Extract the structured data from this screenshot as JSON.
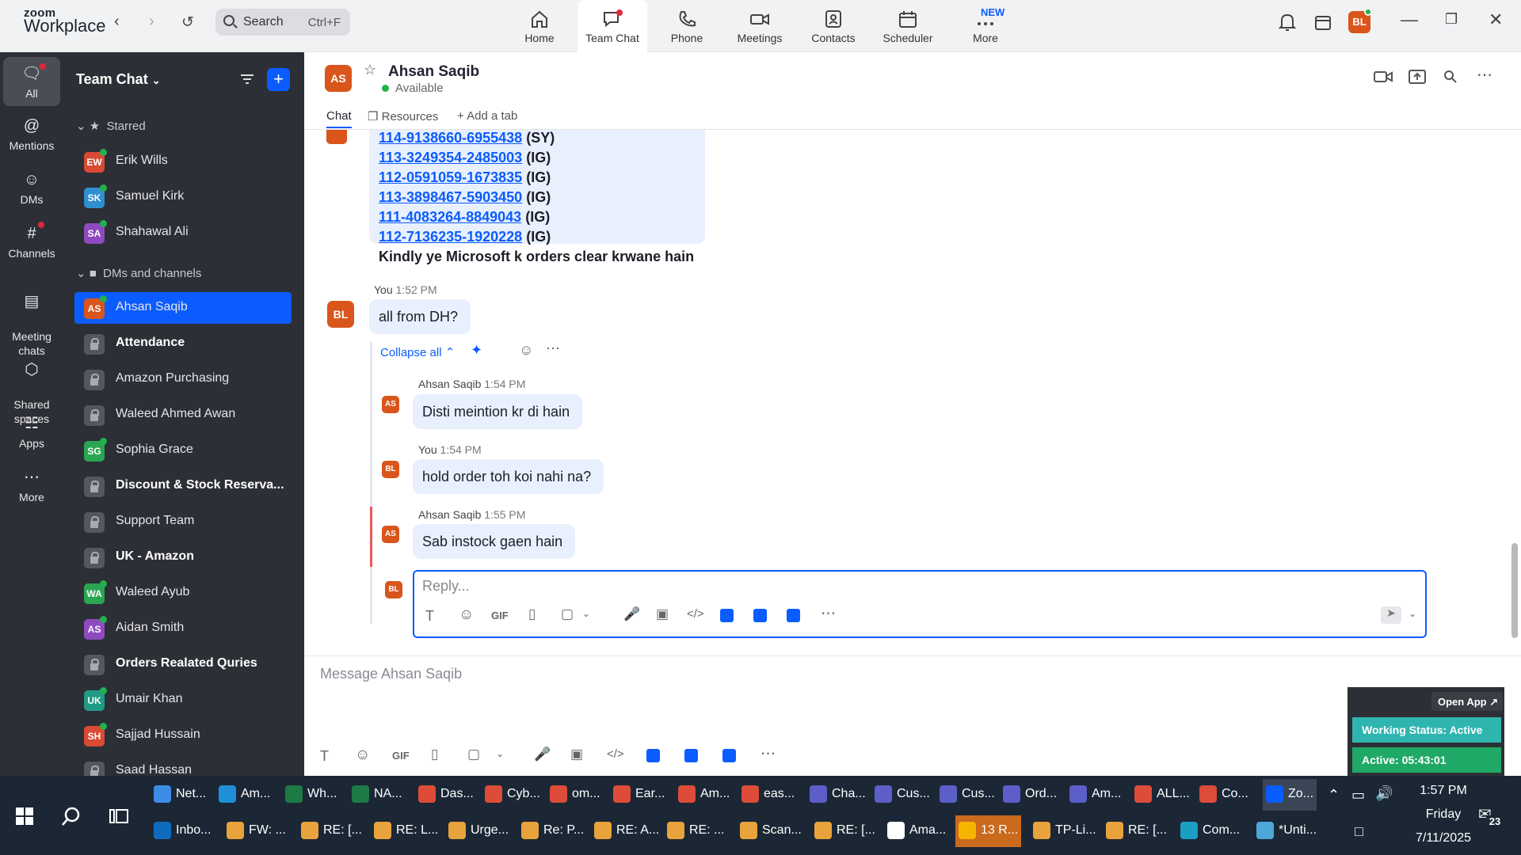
{
  "app": {
    "logo_top": "zoom",
    "logo_bottom": "Workplace"
  },
  "search": {
    "label": "Search",
    "shortcut": "Ctrl+F"
  },
  "nav": [
    {
      "label": "Home",
      "icon": "home-icon"
    },
    {
      "label": "Team Chat",
      "icon": "chat-icon"
    },
    {
      "label": "Phone",
      "icon": "phone-icon"
    },
    {
      "label": "Meetings",
      "icon": "video-icon"
    },
    {
      "label": "Contacts",
      "icon": "contacts-icon"
    },
    {
      "label": "Scheduler",
      "icon": "calendar-icon"
    },
    {
      "label": "More",
      "icon": "more-icon"
    }
  ],
  "new_badge": "NEW",
  "user_initials": "BL",
  "rail": [
    {
      "label": "All"
    },
    {
      "label": "Mentions"
    },
    {
      "label": "DMs"
    },
    {
      "label": "Channels"
    },
    {
      "label": "Meeting\nchats"
    },
    {
      "label": "Shared\nspaces"
    },
    {
      "label": "Apps"
    },
    {
      "label": "More"
    }
  ],
  "sidebar": {
    "title": "Team Chat",
    "starred_label": "Starred",
    "dms_label": "DMs and channels",
    "starred": [
      {
        "initials": "EW",
        "name": "Erik Wills",
        "color": "#d94a33"
      },
      {
        "initials": "SK",
        "name": "Samuel Kirk",
        "color": "#2f8fcf"
      },
      {
        "initials": "SA",
        "name": "Shahawal Ali",
        "color": "#8d4bbf"
      }
    ],
    "items": [
      {
        "initials": "AS",
        "name": "Ahsan Saqib",
        "color": "#d9551c",
        "bold": false
      },
      {
        "initials": "",
        "name": "Attendance",
        "bold": true
      },
      {
        "initials": "",
        "name": "Amazon Purchasing",
        "bold": false
      },
      {
        "initials": "",
        "name": "Waleed Ahmed Awan",
        "bold": false
      },
      {
        "initials": "SG",
        "name": "Sophia Grace",
        "color": "#2aa652",
        "bold": false
      },
      {
        "initials": "",
        "name": "Discount & Stock Reserva...",
        "bold": true
      },
      {
        "initials": "",
        "name": "Support Team",
        "bold": false
      },
      {
        "initials": "",
        "name": "UK - Amazon",
        "bold": true
      },
      {
        "initials": "WA",
        "name": "Waleed Ayub",
        "color": "#2aa652",
        "bold": false
      },
      {
        "initials": "AS",
        "name": "Aidan Smith",
        "color": "#8d4bbf",
        "bold": false
      },
      {
        "initials": "",
        "name": "Orders Realated Quries",
        "bold": true
      },
      {
        "initials": "UK",
        "name": "Umair Khan",
        "color": "#1f9b86",
        "bold": false
      },
      {
        "initials": "SH",
        "name": "Sajjad Hussain",
        "color": "#d94a33",
        "bold": false
      },
      {
        "initials": "",
        "name": "Saad Hassan",
        "bold": false
      }
    ]
  },
  "chat": {
    "contact_initials": "AS",
    "contact_name": "Ahsan Saqib",
    "status": "Available",
    "tabs": {
      "chat": "Chat",
      "resources": "Resources",
      "add": "Add a tab"
    }
  },
  "messages": {
    "order_lines": [
      {
        "id": "114-9138660-6955438",
        "tag": "(SY)"
      },
      {
        "id": "113-3249354-2485003",
        "tag": "(IG)"
      },
      {
        "id": "112-0591059-1673835",
        "tag": "(IG)"
      },
      {
        "id": "113-3898467-5903450",
        "tag": "(IG)"
      },
      {
        "id": "111-4083264-8849043",
        "tag": "(IG)"
      },
      {
        "id": "112-7136235-1920228",
        "tag": "(IG)"
      }
    ],
    "order_note": "Kindly ye Microsoft k orders clear krwane hain",
    "m1_sender": "You",
    "m1_time": "1:52 PM",
    "m1_text": "all from DH?",
    "collapse": "Collapse all",
    "r1_sender": "Ahsan Saqib",
    "r1_time": "1:54 PM",
    "r1_text": "Disti meintion kr di hain",
    "r2_sender": "You",
    "r2_time": "1:54 PM",
    "r2_text": "hold order toh koi nahi na?",
    "r3_sender": "Ahsan Saqib",
    "r3_time": "1:55 PM",
    "r3_text": "Sab instock gaen hain",
    "reply_placeholder": "Reply..."
  },
  "composer": {
    "placeholder": "Message Ahsan Saqib",
    "gif": "GIF"
  },
  "widget": {
    "open_app": "Open App ↗",
    "status": "Working Status: Active",
    "timer": "Active: 05:43:01"
  },
  "taskbar": {
    "row1": [
      {
        "label": "Net...",
        "color": "#3c8ce7"
      },
      {
        "label": "Am...",
        "color": "#1f8fd8"
      },
      {
        "label": "Wh...",
        "color": "#1d7a44"
      },
      {
        "label": "NA...",
        "color": "#1d7a44"
      },
      {
        "label": "Das...",
        "color": "#dd4b39"
      },
      {
        "label": "Cyb...",
        "color": "#dd4b39"
      },
      {
        "label": "om...",
        "color": "#dd4b39"
      },
      {
        "label": "Ear...",
        "color": "#dd4b39"
      },
      {
        "label": "Am...",
        "color": "#dd4b39"
      },
      {
        "label": "eas...",
        "color": "#dd4b39"
      },
      {
        "label": "Cha...",
        "color": "#5b5fc7"
      },
      {
        "label": "Cus...",
        "color": "#5b5fc7"
      },
      {
        "label": "Cus...",
        "color": "#5b5fc7"
      },
      {
        "label": "Ord...",
        "color": "#5b5fc7"
      },
      {
        "label": "Am...",
        "color": "#5b5fc7"
      },
      {
        "label": "ALL...",
        "color": "#dd4b39"
      },
      {
        "label": "Co...",
        "color": "#dd4b39"
      },
      {
        "label": "Zo...",
        "color": "#0b5cff"
      }
    ],
    "row2": [
      {
        "label": "Inbo...",
        "color": "#0f6cbd"
      },
      {
        "label": "FW: ...",
        "color": "#e8a33d"
      },
      {
        "label": "RE: [...",
        "color": "#e8a33d"
      },
      {
        "label": "RE: L...",
        "color": "#e8a33d"
      },
      {
        "label": "Urge...",
        "color": "#e8a33d"
      },
      {
        "label": "Re: P...",
        "color": "#e8a33d"
      },
      {
        "label": "RE: A...",
        "color": "#e8a33d"
      },
      {
        "label": "RE: ...",
        "color": "#e8a33d"
      },
      {
        "label": "Scan...",
        "color": "#e8a33d"
      },
      {
        "label": "RE: [...",
        "color": "#e8a33d"
      },
      {
        "label": "Ama...",
        "color": "#ffffff"
      },
      {
        "label": "13 R...",
        "color": "#f5b400"
      },
      {
        "label": "TP-Li...",
        "color": "#e8a33d"
      },
      {
        "label": "RE: [...",
        "color": "#e8a33d"
      },
      {
        "label": "Com...",
        "color": "#1b9ec4"
      },
      {
        "label": "*Unti...",
        "color": "#4ea7d9"
      }
    ],
    "time": "1:57 PM",
    "day": "Friday",
    "date": "7/11/2025",
    "notifications": "23"
  }
}
